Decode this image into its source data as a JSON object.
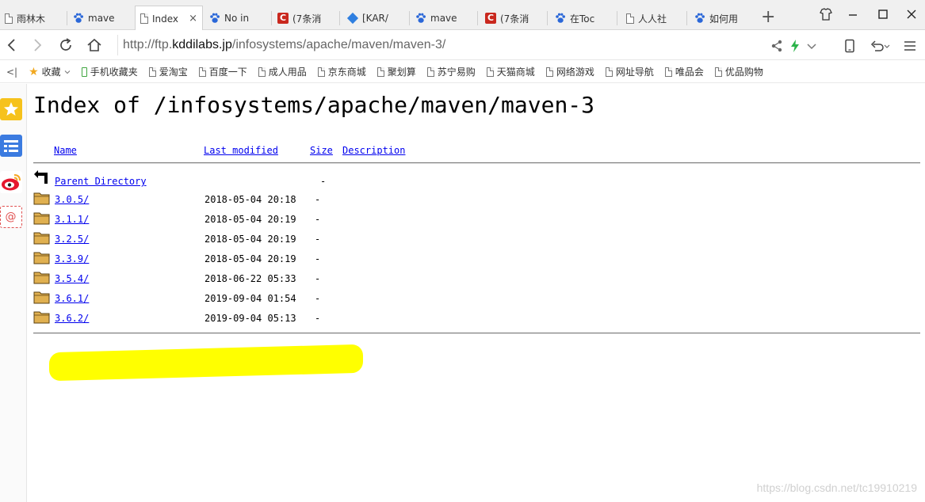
{
  "tabs": [
    {
      "label": "雨林木",
      "icon": "page-icon",
      "active": false
    },
    {
      "label": "mave",
      "icon": "baidu-paw-icon",
      "active": false
    },
    {
      "label": "Index",
      "icon": "page-icon",
      "active": true
    },
    {
      "label": "No in",
      "icon": "baidu-paw-icon",
      "active": false
    },
    {
      "label": "(7条消",
      "icon": "csdn-icon",
      "active": false
    },
    {
      "label": "[KAR/",
      "icon": "diamond-icon",
      "active": false
    },
    {
      "label": "mave",
      "icon": "baidu-paw-icon",
      "active": false
    },
    {
      "label": "(7条消",
      "icon": "csdn-icon",
      "active": false
    },
    {
      "label": "在Toc",
      "icon": "baidu-paw-icon",
      "active": false
    },
    {
      "label": "人人社",
      "icon": "page-icon",
      "active": false
    },
    {
      "label": "如何用",
      "icon": "baidu-paw-icon",
      "active": false
    }
  ],
  "tab_close_glyph": "×",
  "new_tab_glyph": "+",
  "address": {
    "prefix": "http://ftp.",
    "host": "kddilabs.jp",
    "path": "/infosystems/apache/maven/maven-3/"
  },
  "bookmarks": [
    {
      "label": "收藏",
      "icon": "star-icon",
      "dropdown": true
    },
    {
      "label": "手机收藏夹",
      "icon": "phone-icon"
    },
    {
      "label": "爱淘宝",
      "icon": "page-icon"
    },
    {
      "label": "百度一下",
      "icon": "page-icon"
    },
    {
      "label": "成人用品",
      "icon": "page-icon"
    },
    {
      "label": "京东商城",
      "icon": "page-icon"
    },
    {
      "label": "聚划算",
      "icon": "page-icon"
    },
    {
      "label": "苏宁易购",
      "icon": "page-icon"
    },
    {
      "label": "天猫商城",
      "icon": "page-icon"
    },
    {
      "label": "网络游戏",
      "icon": "page-icon"
    },
    {
      "label": "网址导航",
      "icon": "page-icon"
    },
    {
      "label": "唯品会",
      "icon": "page-icon"
    },
    {
      "label": "优品购物",
      "icon": "page-icon"
    }
  ],
  "page": {
    "title": "Index of /infosystems/apache/maven/maven-3",
    "columns": {
      "name": "Name",
      "modified": "Last modified",
      "size": "Size",
      "description": "Description"
    },
    "parent": {
      "name": "Parent Directory",
      "size": "-"
    },
    "rows": [
      {
        "name": "3.0.5/",
        "modified": "2018-05-04 20:18",
        "size": "-"
      },
      {
        "name": "3.1.1/",
        "modified": "2018-05-04 20:19",
        "size": "-"
      },
      {
        "name": "3.2.5/",
        "modified": "2018-05-04 20:19",
        "size": "-"
      },
      {
        "name": "3.3.9/",
        "modified": "2018-05-04 20:19",
        "size": "-"
      },
      {
        "name": "3.5.4/",
        "modified": "2018-06-22 05:33",
        "size": "-",
        "highlighted": true
      },
      {
        "name": "3.6.1/",
        "modified": "2019-09-04 01:54",
        "size": "-"
      },
      {
        "name": "3.6.2/",
        "modified": "2019-09-04 05:13",
        "size": "-"
      }
    ]
  },
  "colors": {
    "link": "#0000ee",
    "highlight": "#ffff00",
    "folder": "#e0b050"
  },
  "watermark": "https://blog.csdn.net/tc19910219"
}
